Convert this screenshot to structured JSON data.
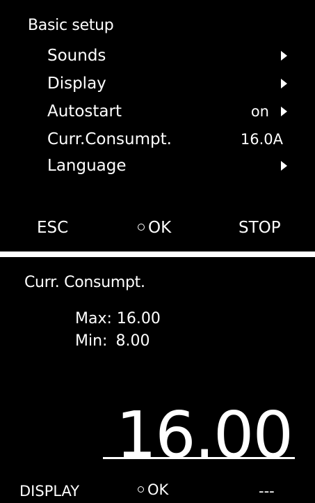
{
  "menu_screen": {
    "title": "Basic setup",
    "items": [
      {
        "label": "Sounds",
        "value": "",
        "has_arrow": true
      },
      {
        "label": "Display",
        "value": "",
        "has_arrow": true
      },
      {
        "label": "Autostart",
        "value": "on",
        "has_arrow": true
      },
      {
        "label": "Curr.Consumpt.",
        "value": "16.0A",
        "has_arrow": false
      },
      {
        "label": "Language",
        "value": "",
        "has_arrow": true
      }
    ],
    "softkeys": {
      "left": "ESC",
      "center": "OK",
      "right": "STOP"
    }
  },
  "value_screen": {
    "title": "Curr. Consumpt.",
    "max_label": "Max:",
    "max_value": "16.00",
    "min_label": "Min:",
    "min_value": "8.00",
    "current_value": "16.00",
    "softkeys": {
      "left": "DISPLAY",
      "center": "OK",
      "right": "---"
    }
  },
  "colors": {
    "screen_bg": "#000000",
    "text": "#ffffff",
    "divider": "#ffffff"
  },
  "icons": {
    "menu_arrow": "triangle-right-icon",
    "ok_marker": "circle-outline-icon"
  }
}
